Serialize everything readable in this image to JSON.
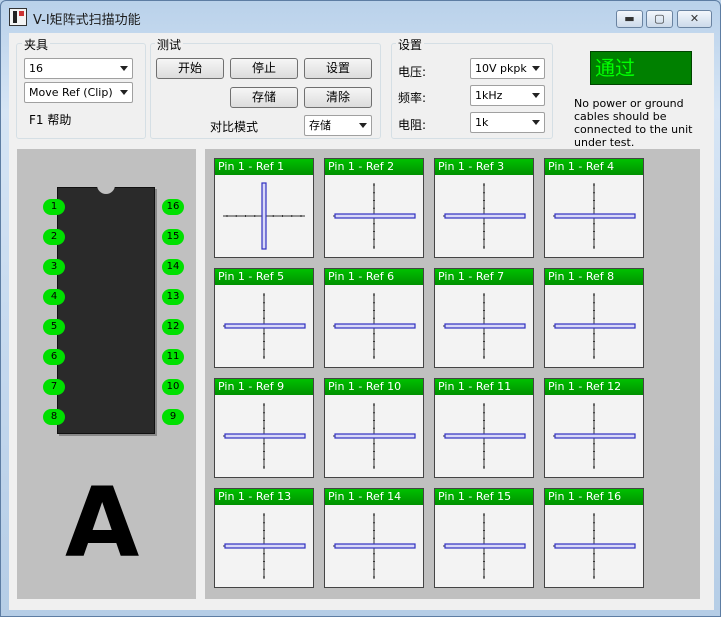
{
  "window": {
    "title": "V-I矩阵式扫描功能",
    "min": "▬",
    "max": "▢",
    "close": "✕"
  },
  "fixture": {
    "label": "夹具",
    "pins_value": "16",
    "mode_value": "Move Ref (Clip)",
    "help": "F1 帮助"
  },
  "test": {
    "label": "测试",
    "start": "开始",
    "stop": "停止",
    "settings": "设置",
    "save": "存储",
    "clear": "清除",
    "compare_label": "对比模式",
    "compare_value": "存储"
  },
  "setup": {
    "label": "设置",
    "voltage_label": "电压:",
    "voltage_value": "10V pkpk",
    "freq_label": "频率:",
    "freq_value": "1kHz",
    "res_label": "电阻:",
    "res_value": "1k"
  },
  "status": {
    "result": "通过",
    "note": "No power or ground cables should be connected to the unit under test."
  },
  "chip": {
    "letter": "A",
    "left_pins": [
      "1",
      "2",
      "3",
      "4",
      "5",
      "6",
      "7",
      "8"
    ],
    "right_pins": [
      "16",
      "15",
      "14",
      "13",
      "12",
      "11",
      "10",
      "9"
    ]
  },
  "cells": [
    {
      "label": "Pin 1 - Ref 1",
      "trace": "vertical"
    },
    {
      "label": "Pin 1 - Ref 2",
      "trace": "horizontal"
    },
    {
      "label": "Pin 1 - Ref 3",
      "trace": "horizontal"
    },
    {
      "label": "Pin 1 - Ref 4",
      "trace": "horizontal"
    },
    {
      "label": "Pin 1 - Ref 5",
      "trace": "horizontal"
    },
    {
      "label": "Pin 1 - Ref 6",
      "trace": "horizontal"
    },
    {
      "label": "Pin 1 - Ref 7",
      "trace": "horizontal"
    },
    {
      "label": "Pin 1 - Ref 8",
      "trace": "horizontal"
    },
    {
      "label": "Pin 1 - Ref 9",
      "trace": "horizontal"
    },
    {
      "label": "Pin 1 - Ref 10",
      "trace": "horizontal"
    },
    {
      "label": "Pin 1 - Ref 11",
      "trace": "horizontal"
    },
    {
      "label": "Pin 1 - Ref 12",
      "trace": "horizontal"
    },
    {
      "label": "Pin 1 - Ref 13",
      "trace": "horizontal"
    },
    {
      "label": "Pin 1 - Ref 14",
      "trace": "horizontal"
    },
    {
      "label": "Pin 1 - Ref 15",
      "trace": "horizontal"
    },
    {
      "label": "Pin 1 - Ref 16",
      "trace": "horizontal"
    }
  ],
  "colors": {
    "pass_bg": "#008000",
    "pass_text": "#00ff00",
    "pin": "#00e000",
    "trace": "#3030c0"
  }
}
